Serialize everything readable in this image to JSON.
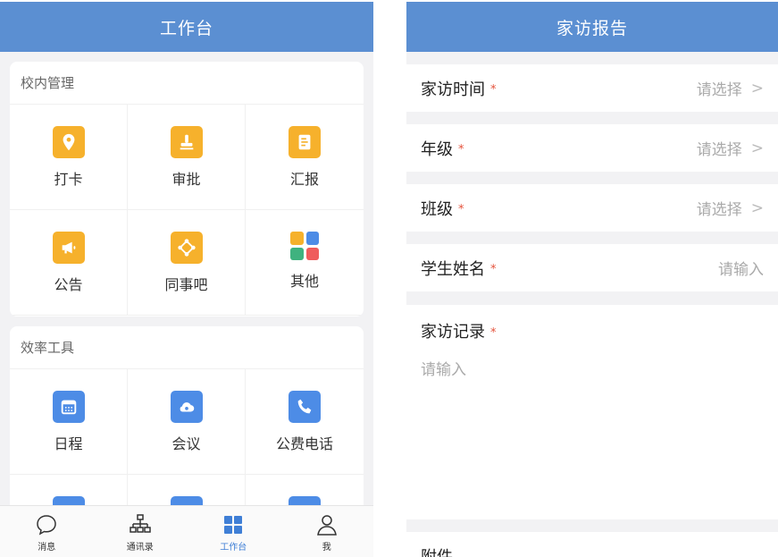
{
  "left": {
    "title": "工作台",
    "campus": {
      "title": "校内管理",
      "items": [
        {
          "label": "打卡",
          "icon": "location-pin-icon"
        },
        {
          "label": "审批",
          "icon": "stamp-icon"
        },
        {
          "label": "汇报",
          "icon": "report-icon"
        },
        {
          "label": "公告",
          "icon": "megaphone-icon"
        },
        {
          "label": "同事吧",
          "icon": "network-icon"
        },
        {
          "label": "其他",
          "icon": "apps-grid-icon"
        }
      ]
    },
    "tools": {
      "title": "效率工具",
      "items": [
        {
          "label": "日程",
          "icon": "calendar-icon"
        },
        {
          "label": "会议",
          "icon": "cloud-icon"
        },
        {
          "label": "公费电话",
          "icon": "phone-icon"
        }
      ]
    },
    "tabbar": [
      {
        "label": "消息",
        "icon": "chat-bubble-icon"
      },
      {
        "label": "通讯录",
        "icon": "org-chart-icon"
      },
      {
        "label": "工作台",
        "icon": "grid-icon",
        "active": true
      },
      {
        "label": "我",
        "icon": "person-icon"
      }
    ]
  },
  "right": {
    "title": "家访报告",
    "fields": [
      {
        "label": "家访时间",
        "value": "请选择"
      },
      {
        "label": "年级",
        "value": "请选择"
      },
      {
        "label": "班级",
        "value": "请选择"
      },
      {
        "label": "学生姓名",
        "value": "请输入"
      }
    ],
    "record": {
      "label": "家访记录",
      "placeholder": "请输入"
    },
    "attachment": "附件",
    "required_mark": "*",
    "chevron": ">"
  },
  "colors": {
    "nav_blue": "#5b8fd2",
    "icon_orange": "#f6b12c",
    "icon_blue": "#4d8ce6",
    "active_tab": "#3f7fd6",
    "required_red": "#e5533c"
  }
}
